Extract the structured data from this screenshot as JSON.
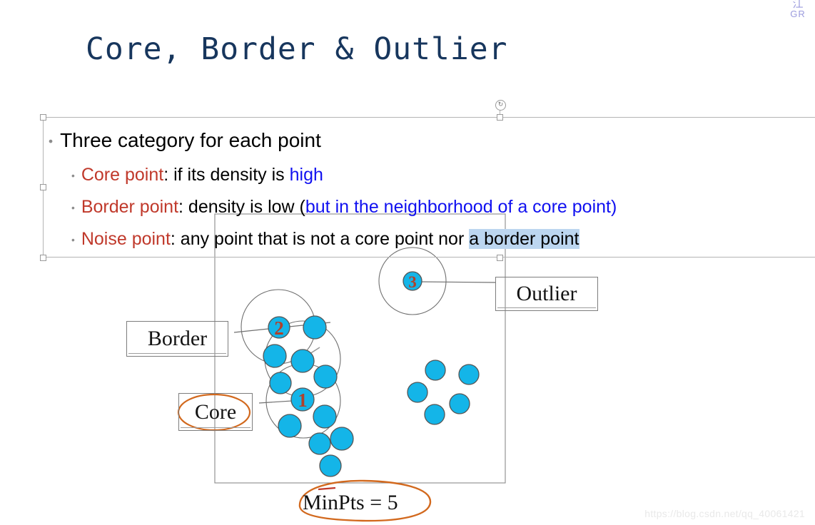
{
  "slide": {
    "title": "Core, Border & Outlier",
    "title_color": "#17365d"
  },
  "bullets": {
    "level1": "Three category for each point",
    "items": [
      {
        "term": "Core point",
        "rest_before": ": if its density is ",
        "highlight": "high",
        "rest_after": ""
      },
      {
        "term": "Border point",
        "rest_before": ": density is low (",
        "highlight": "but in the neighborhood of a core point)",
        "rest_after": ""
      },
      {
        "term": "Noise point",
        "rest_before": ": any point that is not a core point nor ",
        "selected": "a border point",
        "rest_after": ""
      }
    ],
    "term_color": "#c0392b",
    "highlight_color": "#1010f0",
    "selection_color": "#bcd6f0",
    "bullet_glyph": "•"
  },
  "diagram": {
    "labels": {
      "border": "Border",
      "core": "Core",
      "outlier": "Outlier"
    },
    "minpts": "MinPts = 5",
    "point_numbers": [
      "1",
      "2",
      "3"
    ],
    "dot_fill": "#14b5e8",
    "dot_stroke": "#555555",
    "number_color": "#c0392b",
    "annotation_color": "#d2691e",
    "frame_stroke": "#7d7d7d"
  },
  "chrome": {
    "watermark": "https://blog.csdn.net/qq_40061421",
    "logo_glyph": "江",
    "logo_word": "GR",
    "rotate_icon": "↻"
  }
}
